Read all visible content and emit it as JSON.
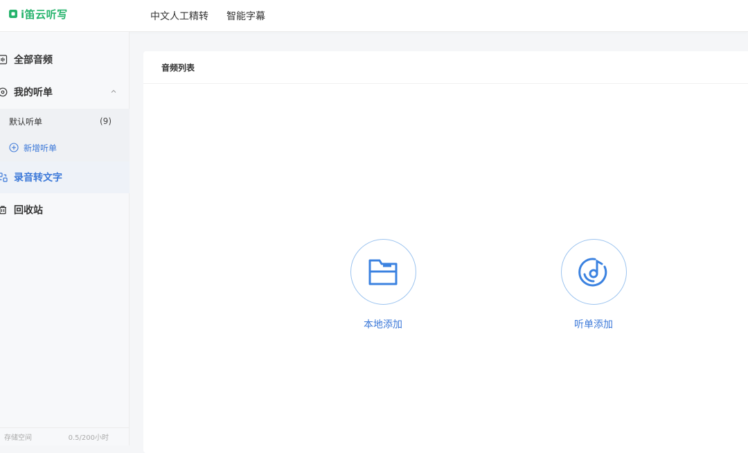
{
  "app": {
    "logo_text": "i笛云听写"
  },
  "topnav": {
    "items": [
      "中文人工精转",
      "智能字幕"
    ]
  },
  "sidebar": {
    "items": [
      {
        "label": "全部音频",
        "icon": "audio-file-icon"
      },
      {
        "label": "我的听单",
        "icon": "disc-icon",
        "expanded": true
      },
      {
        "label": "录音转文字",
        "icon": "convert-icon",
        "active": true
      },
      {
        "label": "回收站",
        "icon": "trash-icon"
      }
    ],
    "playlists": [
      {
        "label": "默认听单",
        "count": "(9)"
      }
    ],
    "new_playlist_label": "新增听单",
    "storage": {
      "label": "存储空间",
      "value": "0.5/200小时"
    }
  },
  "panel": {
    "title": "音频列表",
    "options": [
      {
        "label": "本地添加",
        "icon": "folder-icon"
      },
      {
        "label": "听单添加",
        "icon": "music-disc-icon"
      }
    ]
  },
  "colors": {
    "accent": "#3b78d8",
    "brand": "#24b36b",
    "circle_border": "#9bc3ef"
  }
}
